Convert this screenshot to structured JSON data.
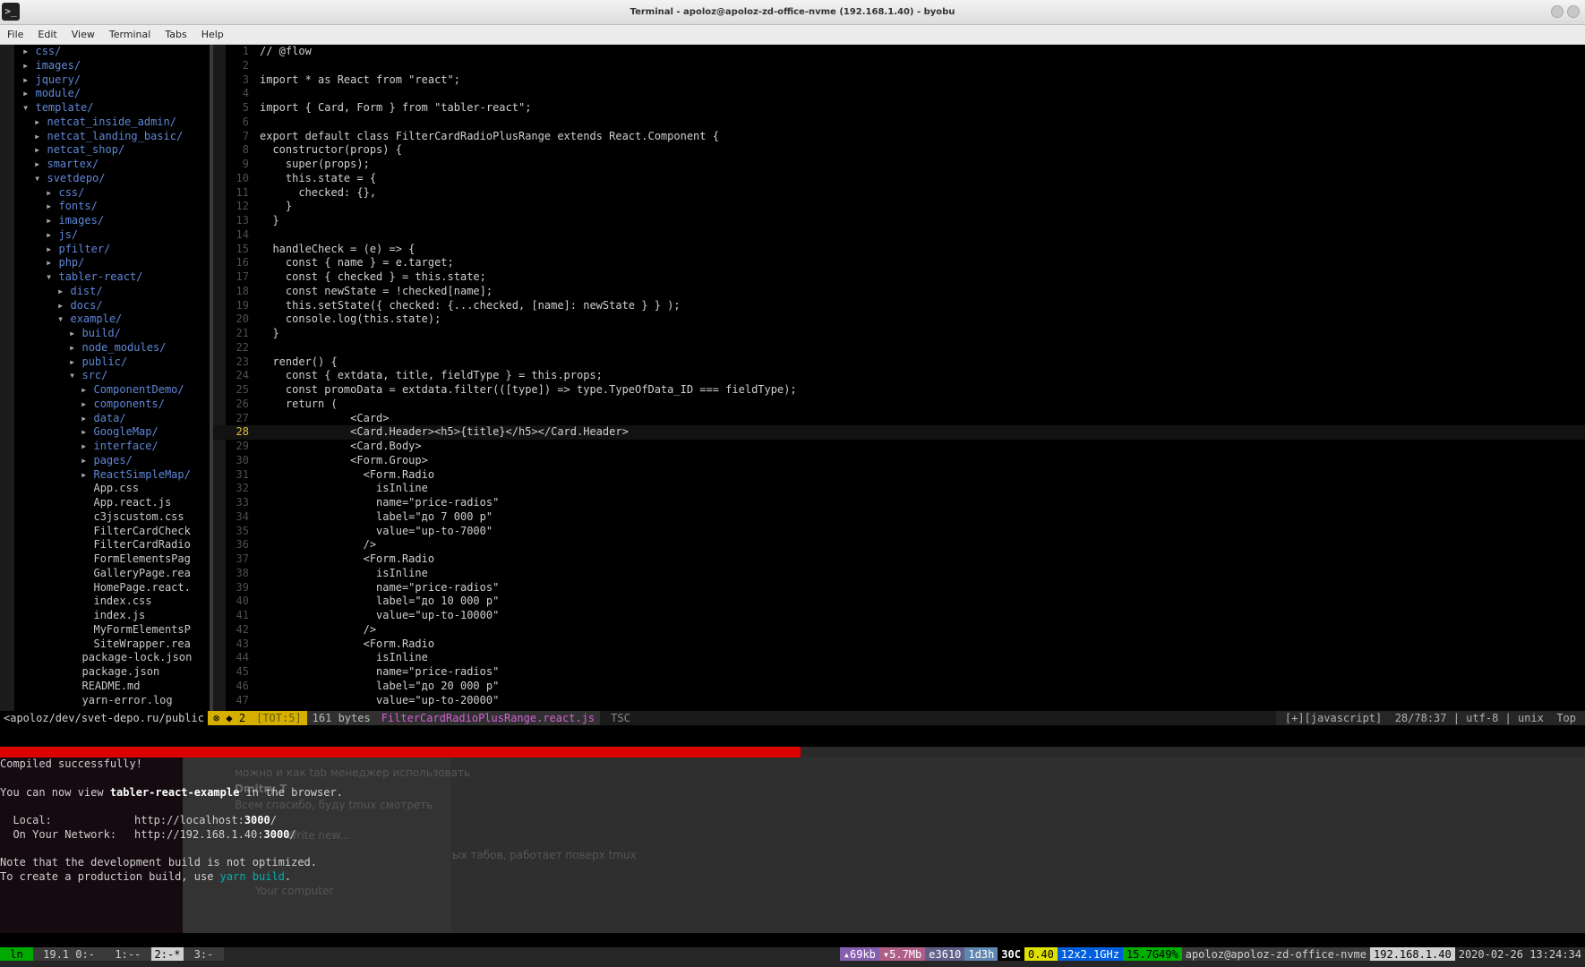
{
  "window": {
    "title": "Terminal - apoloz@apoloz-zd-office-nvme (192.168.1.40) - byobu",
    "menu": [
      "File",
      "Edit",
      "View",
      "Terminal",
      "Tabs",
      "Help"
    ]
  },
  "tree": [
    {
      "indent": 1,
      "arrow": "▸",
      "name": "css/",
      "dir": true
    },
    {
      "indent": 1,
      "arrow": "▸",
      "name": "images/",
      "dir": true
    },
    {
      "indent": 1,
      "arrow": "▸",
      "name": "jquery/",
      "dir": true
    },
    {
      "indent": 1,
      "arrow": "▸",
      "name": "module/",
      "dir": true
    },
    {
      "indent": 1,
      "arrow": "▾",
      "name": "template/",
      "dir": true
    },
    {
      "indent": 2,
      "arrow": "▸",
      "name": "netcat_inside_admin/",
      "dir": true
    },
    {
      "indent": 2,
      "arrow": "▸",
      "name": "netcat_landing_basic/",
      "dir": true
    },
    {
      "indent": 2,
      "arrow": "▸",
      "name": "netcat_shop/",
      "dir": true
    },
    {
      "indent": 2,
      "arrow": "▸",
      "name": "smartex/",
      "dir": true
    },
    {
      "indent": 2,
      "arrow": "▾",
      "name": "svetdepo/",
      "dir": true
    },
    {
      "indent": 3,
      "arrow": "▸",
      "name": "css/",
      "dir": true
    },
    {
      "indent": 3,
      "arrow": "▸",
      "name": "fonts/",
      "dir": true
    },
    {
      "indent": 3,
      "arrow": "▸",
      "name": "images/",
      "dir": true
    },
    {
      "indent": 3,
      "arrow": "▸",
      "name": "js/",
      "dir": true
    },
    {
      "indent": 3,
      "arrow": "▸",
      "name": "pfilter/",
      "dir": true
    },
    {
      "indent": 3,
      "arrow": "▸",
      "name": "php/",
      "dir": true
    },
    {
      "indent": 3,
      "arrow": "▾",
      "name": "tabler-react/",
      "dir": true
    },
    {
      "indent": 4,
      "arrow": "▸",
      "name": "dist/",
      "dir": true
    },
    {
      "indent": 4,
      "arrow": "▸",
      "name": "docs/",
      "dir": true
    },
    {
      "indent": 4,
      "arrow": "▾",
      "name": "example/",
      "dir": true
    },
    {
      "indent": 5,
      "arrow": "▸",
      "name": "build/",
      "dir": true
    },
    {
      "indent": 5,
      "arrow": "▸",
      "name": "node_modules/",
      "dir": true
    },
    {
      "indent": 5,
      "arrow": "▸",
      "name": "public/",
      "dir": true
    },
    {
      "indent": 5,
      "arrow": "▾",
      "name": "src/",
      "dir": true
    },
    {
      "indent": 6,
      "arrow": "▸",
      "name": "ComponentDemo/",
      "dir": true
    },
    {
      "indent": 6,
      "arrow": "▸",
      "name": "components/",
      "dir": true
    },
    {
      "indent": 6,
      "arrow": "▸",
      "name": "data/",
      "dir": true
    },
    {
      "indent": 6,
      "arrow": "▸",
      "name": "GoogleMap/",
      "dir": true
    },
    {
      "indent": 6,
      "arrow": "▸",
      "name": "interface/",
      "dir": true
    },
    {
      "indent": 6,
      "arrow": "▸",
      "name": "pages/",
      "dir": true
    },
    {
      "indent": 6,
      "arrow": "▸",
      "name": "ReactSimpleMap/",
      "dir": true
    },
    {
      "indent": 6,
      "arrow": " ",
      "name": "App.css",
      "dir": false
    },
    {
      "indent": 6,
      "arrow": " ",
      "name": "App.react.js",
      "dir": false
    },
    {
      "indent": 6,
      "arrow": " ",
      "name": "c3jscustom.css",
      "dir": false
    },
    {
      "indent": 6,
      "arrow": " ",
      "name": "FilterCardCheck",
      "dir": false
    },
    {
      "indent": 6,
      "arrow": " ",
      "name": "FilterCardRadio",
      "dir": false
    },
    {
      "indent": 6,
      "arrow": " ",
      "name": "FormElementsPag",
      "dir": false
    },
    {
      "indent": 6,
      "arrow": " ",
      "name": "GalleryPage.rea",
      "dir": false
    },
    {
      "indent": 6,
      "arrow": " ",
      "name": "HomePage.react.",
      "dir": false
    },
    {
      "indent": 6,
      "arrow": " ",
      "name": "index.css",
      "dir": false
    },
    {
      "indent": 6,
      "arrow": " ",
      "name": "index.js",
      "dir": false
    },
    {
      "indent": 6,
      "arrow": " ",
      "name": "MyFormElementsP",
      "dir": false
    },
    {
      "indent": 6,
      "arrow": " ",
      "name": "SiteWrapper.rea",
      "dir": false
    },
    {
      "indent": 5,
      "arrow": " ",
      "name": "package-lock.json",
      "dir": false
    },
    {
      "indent": 5,
      "arrow": " ",
      "name": "package.json",
      "dir": false
    },
    {
      "indent": 5,
      "arrow": " ",
      "name": "README.md",
      "dir": false
    },
    {
      "indent": 5,
      "arrow": " ",
      "name": "yarn-error.log",
      "dir": false
    }
  ],
  "editor": {
    "current_line": 28,
    "lines": [
      "// @flow",
      "",
      "import * as React from \"react\";",
      "",
      "import { Card, Form } from \"tabler-react\";",
      "",
      "export default class FilterCardRadioPlusRange extends React.Component {",
      "  constructor(props) {",
      "    super(props);",
      "    this.state = {",
      "      checked: {},",
      "    }",
      "  }",
      "",
      "  handleCheck = (e) => {",
      "    const { name } = e.target;",
      "    const { checked } = this.state;",
      "    const newState = !checked[name];",
      "    this.setState({ checked: {...checked, [name]: newState } } );",
      "    console.log(this.state);",
      "  }",
      "",
      "  render() {",
      "    const { extdata, title, fieldType } = this.props;",
      "    const promoData = extdata.filter(([type]) => type.TypeOfData_ID === fieldType);",
      "    return (",
      "              <Card>",
      "              <Card.Header><h5>{title}</h5></Card.Header>",
      "              <Card.Body>",
      "              <Form.Group>",
      "                <Form.Radio",
      "                  isInline",
      "                  name=\"price-radios\"",
      "                  label=\"до 7 000 р\"",
      "                  value=\"up-to-7000\"",
      "                />",
      "                <Form.Radio",
      "                  isInline",
      "                  name=\"price-radios\"",
      "                  label=\"до 10 000 р\"",
      "                  value=\"up-to-10000\"",
      "                />",
      "                <Form.Radio",
      "                  isInline",
      "                  name=\"price-radios\"",
      "                  label=\"до 20 000 р\"",
      "                  value=\"up-to-20000\""
    ]
  },
  "statusline": {
    "path": "<apoloz/dev/svet-depo.ru/public",
    "errors": "⊗ ◆ 2",
    "tot": "[TOT:5]",
    "bytes": "161 bytes",
    "filename": "FilterCardRadioPlusRange.react.js",
    "tsc": "TSC",
    "right": "[+][javascript]  28/78:37 | utf-8 | unix  Top"
  },
  "progress": {
    "fraction": 0.505
  },
  "terminal": {
    "compiled": "Compiled successfully!",
    "view_pre": "You can now view ",
    "view_app": "tabler-react-example",
    "view_post": " in the browser.",
    "local_label": "  Local:",
    "local_url_pre": "http://localhost:",
    "local_port": "3000",
    "local_url_post": "/",
    "net_label": "  On Your Network:",
    "net_url_pre": "http://192.168.1.40:",
    "net_port": "3000",
    "net_url_post": "/",
    "note": "Note that the development build is not optimized.",
    "prod_pre": "To create a production build, use ",
    "prod_cmd": "yarn build",
    "prod_post": "."
  },
  "overlay_text": {
    "line1": "можно и как tab менеджер использовать",
    "author": "Dmitry T",
    "line2": "Всем спасибо, буду tmux смотреть",
    "menu": "Write new...",
    "line3": "ых табов, работает поверх tmux",
    "line4": "Your computer"
  },
  "tmux": {
    "ln": " ln ",
    "w1": " 19.1 0:- ",
    "w2": " 1:-- ",
    "w3": "2:-*",
    "w4": " 3:- ",
    "net1": "▴69kb",
    "net2": "▾5.7Mb",
    "mem": "e3610",
    "cpu": "1d3h",
    "temp": "30C",
    "load": "0.40",
    "freq": "12x2.1GHz",
    "disk": "15.7G49%",
    "host": "apoloz@apoloz-zd-office-nvme",
    "ip": "192.168.1.40",
    "time": "2020-02-26 13:24:34"
  },
  "colors": {
    "dir": "#5f87d7",
    "progress": "#dd0000",
    "statusline_accent": "#d7af00",
    "filename": "#d75fd7"
  }
}
